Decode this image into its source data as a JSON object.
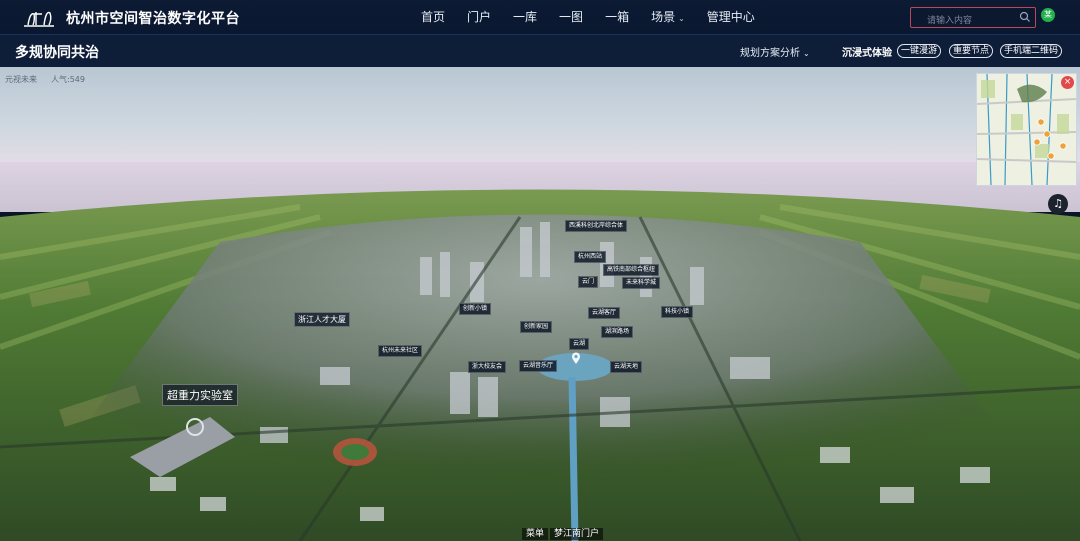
{
  "app": {
    "title": "杭州市空间智治数字化平台"
  },
  "nav": {
    "items": [
      {
        "label": "首页"
      },
      {
        "label": "门户"
      },
      {
        "label": "一库"
      },
      {
        "label": "一图"
      },
      {
        "label": "一箱"
      },
      {
        "label": "场景",
        "has_dropdown": true
      },
      {
        "label": "管理中心"
      }
    ]
  },
  "search": {
    "placeholder": "请输入内容"
  },
  "user": {
    "avatar_text": "某"
  },
  "subheader": {
    "page_title": "多规协同共治",
    "plan_select": "规划方案分析",
    "immersive_label": "沉浸式体验",
    "buttons": [
      "一键漫游",
      "重要节点",
      "手机端二维码"
    ]
  },
  "scene": {
    "watermark": "元视未来",
    "popularity": "人气:549",
    "labels": [
      "西溪科创北岸综合体",
      "杭州西站",
      "高铁南部综合枢纽",
      "云门",
      "未来科学城",
      "科技小镇",
      "云湖客厅",
      "湖滨路场",
      "创新小镇",
      "创新家园",
      "云湖",
      "杭州未来社区",
      "浙大校友会",
      "云湖音乐厅",
      "云湖天地"
    ],
    "big_label": "超重力实验室",
    "side_label": "浙江人才大厦"
  },
  "bottom": {
    "menu": "菜单",
    "portal": "梦江南门户"
  },
  "colors": {
    "nav_bg": "#0c1a33",
    "sub_bg": "#0e1d38",
    "accent_red": "#e24a4a",
    "avatar_green": "#22b14c"
  }
}
